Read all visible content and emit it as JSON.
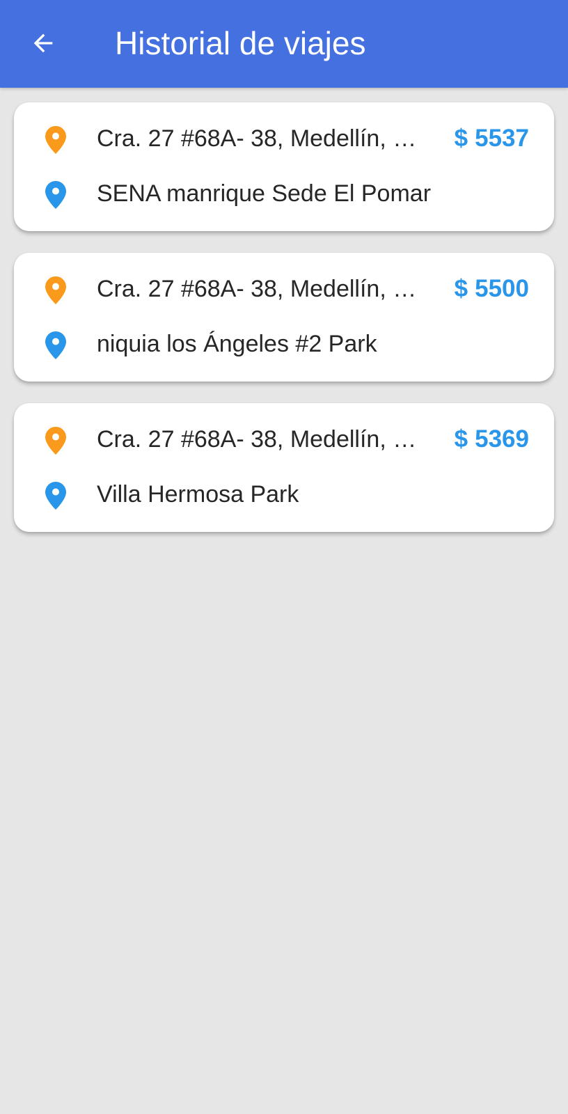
{
  "app_bar": {
    "title": "Historial de viajes",
    "back_icon": "arrow-back-icon",
    "background": "#4570df"
  },
  "colors": {
    "origin_pin": "#f99a1c",
    "destination_pin": "#2a96ea",
    "price": "#2a96ea",
    "background": "#e6e6e6"
  },
  "trips": [
    {
      "origin": "Cra. 27 #68A- 38, Medellín, …",
      "destination": "SENA manrique Sede El Pomar",
      "price_symbol": "$",
      "price": "5537"
    },
    {
      "origin": "Cra. 27 #68A- 38, Medellín, …",
      "destination": "niquia los Ángeles #2 Park",
      "price_symbol": "$",
      "price": "5500"
    },
    {
      "origin": "Cra. 27 #68A- 38, Medellín, …",
      "destination": "Villa Hermosa Park",
      "price_symbol": "$",
      "price": "5369"
    }
  ]
}
